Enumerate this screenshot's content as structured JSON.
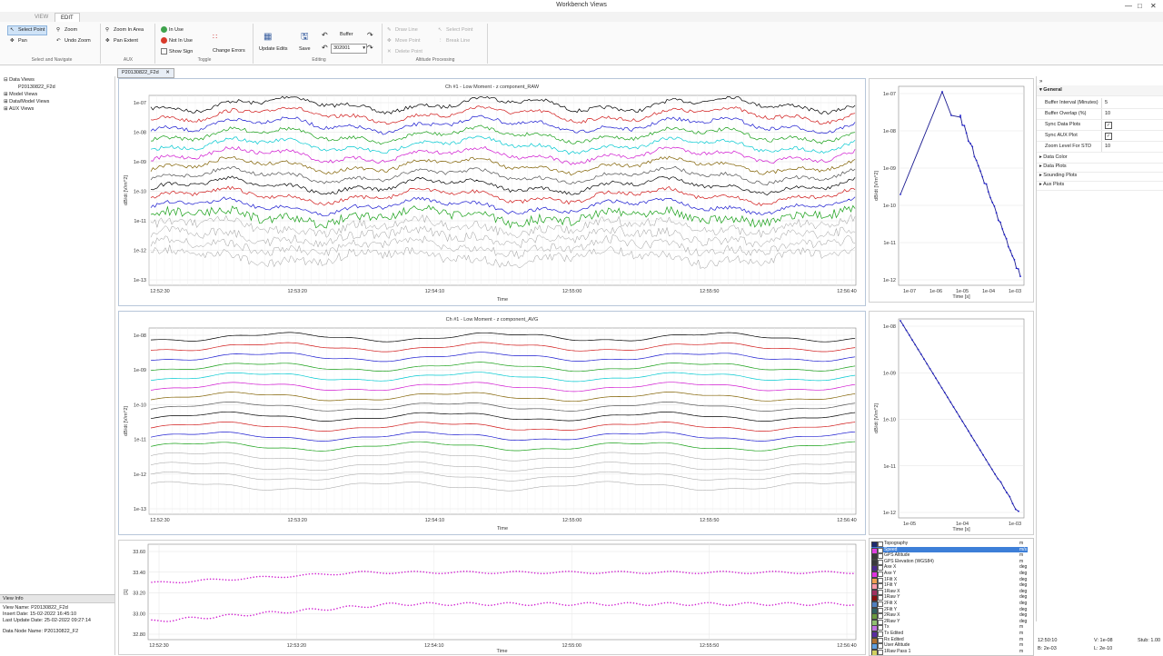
{
  "window": {
    "title": "Workbench Views"
  },
  "tabs": [
    {
      "label": "VIEW",
      "active": false
    },
    {
      "label": "EDIT",
      "active": true
    }
  ],
  "ribbon": {
    "select_navigate": {
      "label": "Select and Navigate",
      "select_point": "Select Point",
      "pan": "Pan",
      "zoom": "Zoom",
      "undo_zoom": "Undo Zoom"
    },
    "aux": {
      "label": "AUX",
      "zoom_in_area": "Zoom In Area",
      "pan_extent": "Pan Extent"
    },
    "toggle": {
      "label": "Toggle",
      "in_use": "In Use",
      "not_in_use": "Not In Use",
      "show_sign": "Show Sign",
      "change_errors": "Change Errors"
    },
    "editing": {
      "label": "Editing",
      "update_edits": "Update Edits",
      "save": "Save",
      "buffer_label": "Buffer",
      "buffer_value": "302001"
    },
    "altitude": {
      "label": "Altitude Processing",
      "draw_line": "Draw Line",
      "move_point": "Move Point",
      "delete_point": "Delete Point",
      "select_point": "Select Point",
      "break_line": "Break Line"
    }
  },
  "document_tab": {
    "label": "P20130822_F2d"
  },
  "tree": [
    {
      "label": "Data Views"
    },
    {
      "label": "P20130822_F2d"
    },
    {
      "label": "Model Views"
    },
    {
      "label": "Data/Model Views"
    },
    {
      "label": "AUX Views"
    }
  ],
  "view_info": {
    "header": "View Info",
    "rows": [
      "View Name:  P20130822_F2d",
      "Insert Date:  15-02-2022 16:45:10",
      "Last Update Date:  25-02-2022 09:27:14",
      "",
      "Data Node Name:  P20130822_F2"
    ]
  },
  "properties": {
    "section": "General",
    "rows": [
      {
        "key": "Buffer Interval (Minutes)",
        "value": "5"
      },
      {
        "key": "Buffer Overlap (%)",
        "value": "10"
      },
      {
        "key": "Sync Data Plots",
        "value": "check"
      },
      {
        "key": "Sync AUX Plot",
        "value": "check"
      },
      {
        "key": "Zoom Level For STD",
        "value": "10"
      }
    ],
    "groups": [
      "Data Color",
      "Data Plots",
      "Sounding Plots",
      "Aux Plots"
    ]
  },
  "legend_items": [
    {
      "name": "Topography",
      "unit": "m",
      "color": "#1f2a6e"
    },
    {
      "name": "Speed",
      "unit": "m/s",
      "color": "#e040e0",
      "selected": true
    },
    {
      "name": "GPS Altitude",
      "unit": "m",
      "color": "#3a3a3a"
    },
    {
      "name": "GPS Elevation (WGS84)",
      "unit": "m",
      "color": "#3a3a3a"
    },
    {
      "name": "Axe X",
      "unit": "deg",
      "color": "#4b2a8a"
    },
    {
      "name": "Axe Y",
      "unit": "deg",
      "color": "#e030e0"
    },
    {
      "name": "1Filt X",
      "unit": "deg",
      "color": "#f0a050"
    },
    {
      "name": "1Filt Y",
      "unit": "deg",
      "color": "#ff9aa8"
    },
    {
      "name": "1Raw X",
      "unit": "deg",
      "color": "#a03060"
    },
    {
      "name": "1Raw Y",
      "unit": "deg",
      "color": "#8a1010"
    },
    {
      "name": "2Filt X",
      "unit": "deg",
      "color": "#5080c0"
    },
    {
      "name": "2Filt Y",
      "unit": "deg",
      "color": "#306060"
    },
    {
      "name": "2Raw X",
      "unit": "deg",
      "color": "#6a9a40"
    },
    {
      "name": "2Raw Y",
      "unit": "deg",
      "color": "#90c070"
    },
    {
      "name": "Tx",
      "unit": "m",
      "color": "#c070e0"
    },
    {
      "name": "Tx Edited",
      "unit": "m",
      "color": "#5a2aa0"
    },
    {
      "name": "Rx Edited",
      "unit": "m",
      "color": "#b07030"
    },
    {
      "name": "User Altitude",
      "unit": "m",
      "color": "#60a0e0"
    },
    {
      "name": "1Raw Pass 1",
      "unit": "m",
      "color": "#d0d060"
    }
  ],
  "status": {
    "time": "12:50:10",
    "v": "V: 1e-08",
    "stub": "Stub: 1.00",
    "b": "B: 2e-03",
    "l": "L: 2e-10"
  },
  "chart_data": [
    {
      "type": "line",
      "title": "Ch #1 - Low Moment - z component_RAW",
      "xlabel": "Time",
      "ylabel": "dB/dt [V/m^2]",
      "x_ticks": [
        "12:52:30",
        "12:53:20",
        "12:54:10",
        "12:55:00",
        "12:55:50",
        "12:56:40"
      ],
      "y_ticks": [
        "1e-07",
        "1e-08",
        "1e-09",
        "1e-10",
        "1e-11",
        "1e-12",
        "1e-13"
      ],
      "y_scale": "log",
      "grid": true
    },
    {
      "type": "line",
      "title": "Ch #1 - Low Moment - z component_AVG",
      "xlabel": "Time",
      "ylabel": "dB/dt [V/m^2]",
      "x_ticks": [
        "12:52:30",
        "12:53:20",
        "12:54:10",
        "12:55:00",
        "12:55:50",
        "12:56:40"
      ],
      "y_ticks": [
        "1e-08",
        "1e-09",
        "1e-10",
        "1e-11",
        "1e-12",
        "1e-13"
      ],
      "y_scale": "log",
      "grid": true
    },
    {
      "type": "line",
      "title": "",
      "xlabel": "Time [s]",
      "ylabel": "dB/dt [V/m^2]",
      "x_ticks": [
        "1e-07",
        "1e-06",
        "1e-05",
        "1e-04",
        "1e-03"
      ],
      "y_ticks": [
        "1e-07",
        "1e-08",
        "1e-09",
        "1e-10",
        "1e-11",
        "1e-12"
      ],
      "x_scale": "log",
      "y_scale": "log",
      "grid": true
    },
    {
      "type": "line",
      "title": "",
      "xlabel": "Time [s]",
      "ylabel": "dB/dt [V/m^2]",
      "x_ticks": [
        "1e-05",
        "1e-04",
        "1e-03"
      ],
      "y_ticks": [
        "1e-08",
        "1e-09",
        "1e-10",
        "1e-11",
        "1e-12"
      ],
      "x_scale": "log",
      "y_scale": "log",
      "grid": true
    },
    {
      "type": "scatter",
      "title": "",
      "xlabel": "Time",
      "ylabel": "[1]",
      "x_ticks": [
        "12:52:30",
        "12:53:20",
        "12:54:10",
        "12:55:00",
        "12:55:50",
        "12:56:40"
      ],
      "y_ticks": [
        "33.60",
        "33.40",
        "33.20",
        "33.00",
        "32.80"
      ],
      "ylim": [
        32.7,
        33.7
      ],
      "grid": true
    }
  ]
}
